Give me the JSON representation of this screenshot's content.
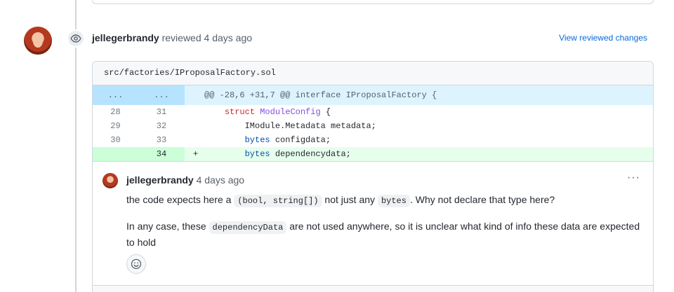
{
  "review": {
    "author": "jellegerbrandy",
    "action": "reviewed",
    "time": "4 days ago",
    "view_changes_label": "View reviewed changes"
  },
  "file": {
    "path": "src/factories/IProposalFactory.sol",
    "hunk": {
      "left": "...",
      "right": "...",
      "text": "@@ -28,6 +31,7 @@ interface IProposalFactory {"
    },
    "lines": [
      {
        "old": "28",
        "new": "31",
        "sign": "",
        "indent": "    ",
        "tokens": [
          {
            "t": "struct",
            "c": "kw"
          },
          {
            "t": " ",
            "c": ""
          },
          {
            "t": "ModuleConfig",
            "c": "ty"
          },
          {
            "t": " {",
            "c": ""
          }
        ]
      },
      {
        "old": "29",
        "new": "32",
        "sign": "",
        "indent": "        ",
        "tokens": [
          {
            "t": "IModule.Metadata metadata;",
            "c": ""
          }
        ]
      },
      {
        "old": "30",
        "new": "33",
        "sign": "",
        "indent": "        ",
        "tokens": [
          {
            "t": "bytes",
            "c": "bl"
          },
          {
            "t": " configdata;",
            "c": ""
          }
        ]
      },
      {
        "old": "",
        "new": "34",
        "sign": "+",
        "indent": "        ",
        "tokens": [
          {
            "t": "bytes",
            "c": "bl"
          },
          {
            "t": " dependencydata;",
            "c": ""
          }
        ],
        "added": true
      }
    ]
  },
  "comment": {
    "author": "jellegerbrandy",
    "time": "4 days ago",
    "more_label": "···",
    "p1": {
      "a": "the code expects here a ",
      "code1": "(bool, string[])",
      "b": " not just any ",
      "code2": "bytes",
      "c": ". Why not declare that type here?"
    },
    "p2": {
      "a": "In any case, these ",
      "code1": "dependencyData",
      "b": " are not used anywhere, so it is unclear what kind of info these data are expected to hold"
    }
  }
}
